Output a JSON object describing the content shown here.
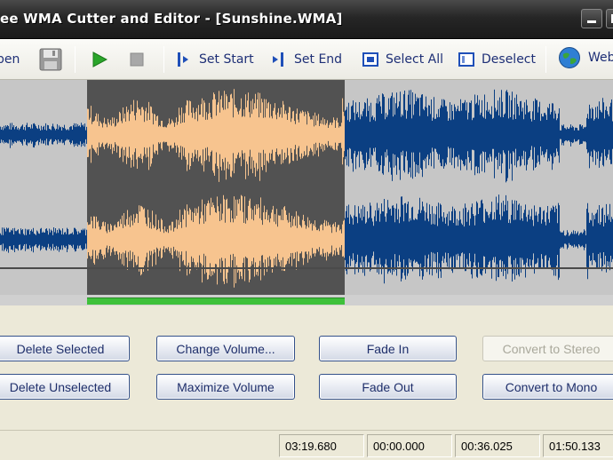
{
  "window": {
    "title": "ee WMA Cutter and Editor - [Sunshine.WMA]"
  },
  "toolbar": {
    "open_label": "pen",
    "set_start_label": "Set Start",
    "set_end_label": "Set End",
    "select_all_label": "Select All",
    "deselect_label": "Deselect",
    "web_label": "Web"
  },
  "icons": {
    "open": "folder-open-icon",
    "save": "floppy-disk-icon",
    "play": "play-icon",
    "stop": "stop-icon",
    "set_start": "set-start-icon",
    "set_end": "set-end-icon",
    "select_all": "select-all-icon",
    "deselect": "deselect-icon",
    "web": "globe-icon"
  },
  "colors": {
    "waveform_unselected": "#0b3f82",
    "waveform_selected": "#f7c48f",
    "selection_background": "#525252",
    "waveform_background": "#c6c6c6",
    "selection_bar": "#3ec13a"
  },
  "selection": {
    "start_fraction": 0.142,
    "end_fraction": 0.562
  },
  "buttons": {
    "delete_selected": "Delete Selected",
    "delete_unselected": "Delete Unselected",
    "change_volume": "Change Volume...",
    "maximize_volume": "Maximize Volume",
    "fade_in": "Fade In",
    "fade_out": "Fade Out",
    "convert_to_stereo": "Convert to Stereo",
    "convert_to_mono": "Convert to Mono"
  },
  "status": {
    "total": "03:19.680",
    "start": "00:00.000",
    "end": "00:36.025",
    "position": "01:50.133"
  }
}
